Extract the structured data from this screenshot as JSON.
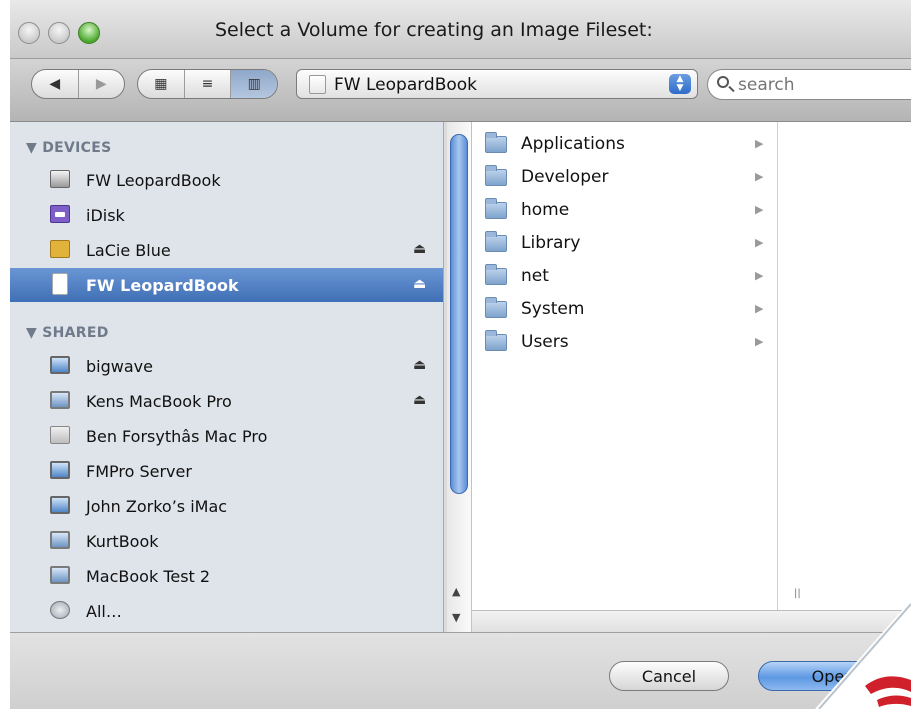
{
  "window": {
    "title": "Select a Volume for creating an Image Fileset:"
  },
  "toolbar": {
    "nav": {
      "back": "◀",
      "forward": "▶"
    },
    "views": {
      "icon": "▦",
      "list": "≡",
      "column": "▥"
    },
    "location": {
      "selected": "FW LeopardBook",
      "stepper_up": "▲",
      "stepper_down": "▼"
    },
    "search": {
      "placeholder": "search"
    }
  },
  "sidebar": {
    "devices_header": "▼ DEVICES",
    "shared_header": "▼ SHARED",
    "eject_glyph": "⏏",
    "devices": [
      {
        "label": "FW LeopardBook",
        "icon": "hard-drive-icon",
        "eject": false,
        "selected": false
      },
      {
        "label": "iDisk",
        "icon": "idisk-icon",
        "eject": false,
        "selected": false
      },
      {
        "label": "LaCie Blue",
        "icon": "lacie-drive-icon",
        "eject": true,
        "selected": false
      },
      {
        "label": "FW LeopardBook",
        "icon": "volume-icon",
        "eject": true,
        "selected": true
      }
    ],
    "shared": [
      {
        "label": "bigwave",
        "icon": "monitor-icon",
        "eject": true
      },
      {
        "label": "Kens MacBook Pro",
        "icon": "macbook-icon",
        "eject": true
      },
      {
        "label": "Ben Forsythâs Mac Pro",
        "icon": "macpro-icon",
        "eject": false
      },
      {
        "label": "FMPro Server",
        "icon": "monitor-icon",
        "eject": false
      },
      {
        "label": "John Zorko’s iMac",
        "icon": "imac-icon",
        "eject": false
      },
      {
        "label": "KurtBook",
        "icon": "macbook-icon",
        "eject": false
      },
      {
        "label": "MacBook Test 2",
        "icon": "macbook-icon",
        "eject": false
      },
      {
        "label": "All…",
        "icon": "network-globe-icon",
        "eject": false
      }
    ]
  },
  "browser": {
    "folders": [
      "Applications",
      "Developer",
      "home",
      "Library",
      "net",
      "System",
      "Users"
    ],
    "chevron": "▶",
    "grip": "||"
  },
  "buttons": {
    "cancel": "Cancel",
    "open": "Open"
  },
  "colors": {
    "selection": "#3f6fb5",
    "sidebar_bg": "#dfe4ea",
    "brand_red": "#d0202b"
  }
}
